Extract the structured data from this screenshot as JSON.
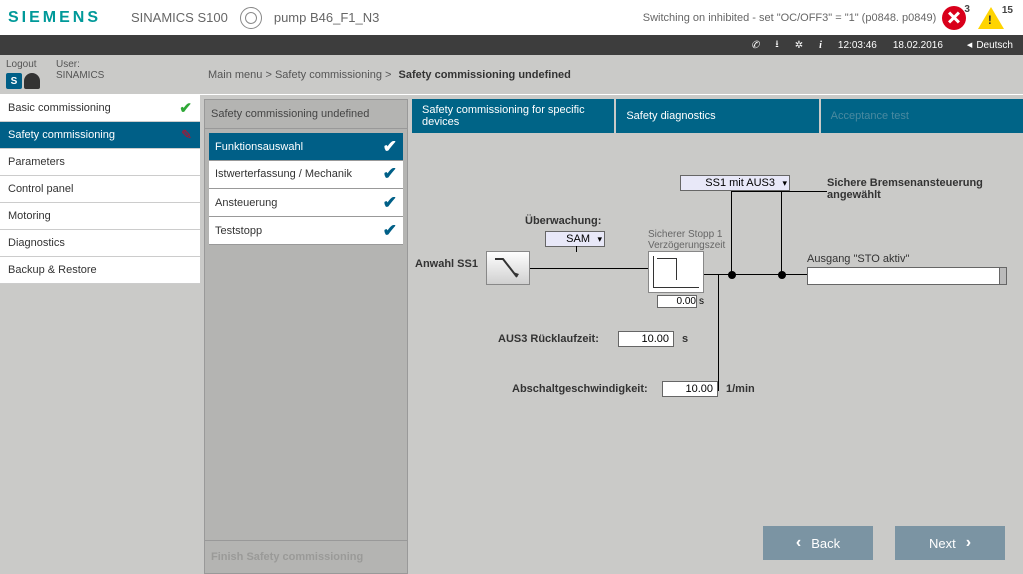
{
  "brand": "SIEMENS",
  "product_line": "SINAMICS S100",
  "device_name": "pump B46_F1_N3",
  "status_message": "Switching on inhibited - set \"OC/OFF3\" = \"1\" (p0848. p0849)",
  "error_count": "3",
  "warning_count": "15",
  "time": "12:03:46",
  "date": "18.02.2016",
  "language": "Deutsch",
  "user_label": "User:",
  "user_name": "SINAMICS",
  "logout": "Logout",
  "breadcrumb": {
    "a": "Main menu",
    "b": "Safety commissioning",
    "c": "Safety commissioning undefined"
  },
  "nav": {
    "items": [
      {
        "label": "Basic commissioning",
        "state": "done"
      },
      {
        "label": "Safety commissioning",
        "state": "editing"
      },
      {
        "label": "Parameters",
        "state": ""
      },
      {
        "label": "Control panel",
        "state": ""
      },
      {
        "label": "Motoring",
        "state": ""
      },
      {
        "label": "Diagnostics",
        "state": ""
      },
      {
        "label": "Backup & Restore",
        "state": ""
      }
    ]
  },
  "stepbox": {
    "title": "Safety commissioning undefined",
    "finish": "Finish Safety commissioning",
    "steps": [
      {
        "label": "Funktionsauswahl",
        "sel": true
      },
      {
        "label": "Istwerterfassung / Mechanik",
        "sel": false
      },
      {
        "label": "Ansteuerung",
        "sel": false
      },
      {
        "label": "Teststopp",
        "sel": false
      }
    ]
  },
  "tabs": [
    "Safety commissioning for specific devices",
    "Safety diagnostics",
    "Acceptance test"
  ],
  "diagram": {
    "ss1_mode": "SS1 mit AUS3",
    "brake_msg": "Sichere Bremsenansteuerung angewählt",
    "monitor_label": "Überwachung:",
    "monitor_value": "SAM",
    "anwahl": "Anwahl SS1",
    "stop_title": "Sicherer Stopp 1 Verzögerungszeit",
    "stop_value": "0.00",
    "stop_unit": "s",
    "aus3_label": "AUS3 Rücklaufzeit:",
    "aus3_value": "10.00",
    "aus3_unit": "s",
    "absch_label": "Abschaltgeschwindigkeit:",
    "absch_value": "10.00",
    "absch_unit": "1/min",
    "output_label": "Ausgang \"STO aktiv\""
  },
  "buttons": {
    "back": "Back",
    "next": "Next"
  }
}
